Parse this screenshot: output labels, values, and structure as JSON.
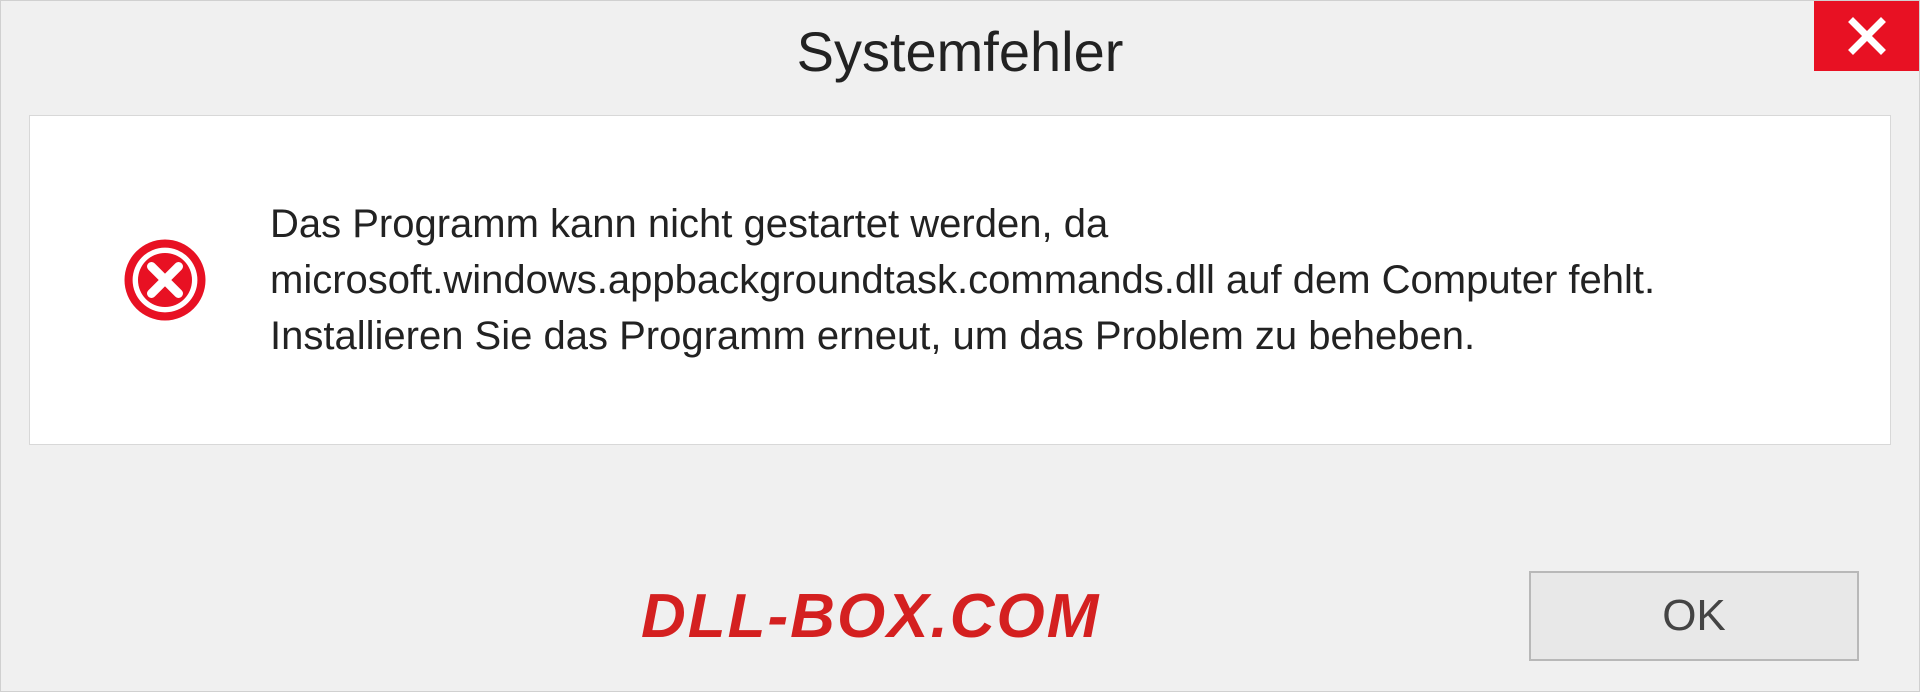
{
  "dialog": {
    "title": "Systemfehler",
    "message": "Das Programm kann nicht gestartet werden, da microsoft.windows.appbackgroundtask.commands.dll auf dem Computer fehlt. Installieren Sie das Programm erneut, um das Problem zu beheben.",
    "ok_label": "OK",
    "watermark": "DLL-BOX.COM"
  }
}
